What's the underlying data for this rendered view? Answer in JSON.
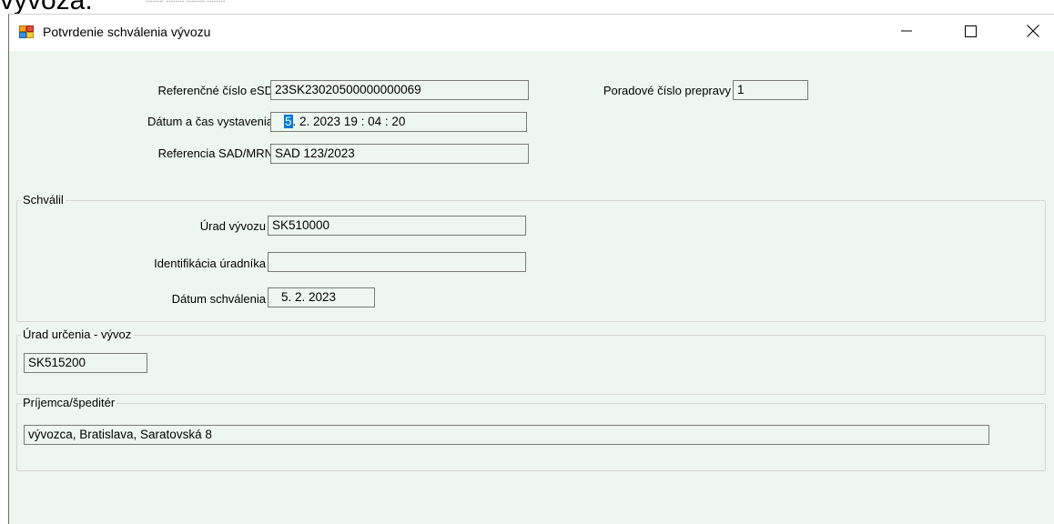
{
  "background": {
    "partial_text": "vývoza.",
    "faint_text": "........ ........ ........ ........"
  },
  "window": {
    "title": "Potvrdenie schválenia vývozu",
    "icon": "form-app-icon",
    "controls": {
      "minimize": "—",
      "maximize": "☐",
      "close": "✕"
    }
  },
  "form": {
    "ref_esd_label": "Referenčné číslo eSD",
    "ref_esd_value": "23SK23020500000000069",
    "poradove_label": "Poradové číslo prepravy",
    "poradove_value": "1",
    "datum_label": "Dátum a čas vystavenia",
    "datum_day": "5",
    "datum_rest": ".  2. 2023  19 : 04 : 20",
    "sad_label": "Referencia SAD/MRN",
    "sad_value": "SAD 123/2023"
  },
  "schvalil": {
    "legend": "Schválil",
    "urad_label": "Úrad vývozu",
    "urad_value": "SK510000",
    "ident_label": "Identifikácia úradníka",
    "ident_value": "",
    "datum_label": "Dátum schválenia",
    "datum_value": "5.   2. 2023"
  },
  "urad_urcenia": {
    "legend": "Úrad určenia - vývoz",
    "value": "SK515200"
  },
  "prijemca": {
    "legend": "Príjemca/špeditér",
    "value": "vývozca, Bratislava, Saratovská 8"
  },
  "colors": {
    "window_bg": "#eef7ef",
    "selection": "#0078d7"
  }
}
